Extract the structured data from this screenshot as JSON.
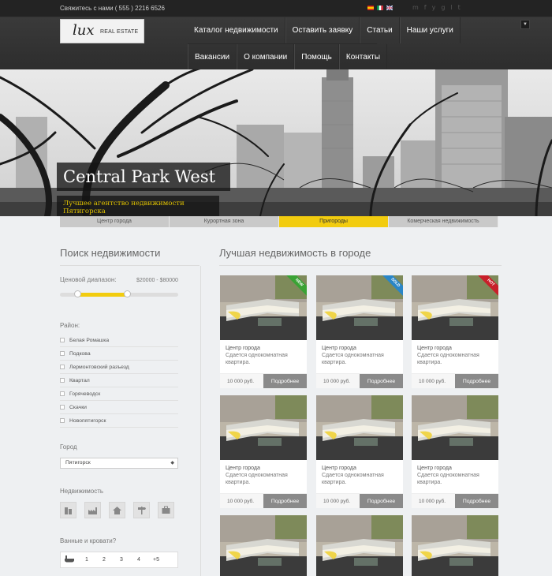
{
  "topbar": {
    "contact": "Свяжитесь с нами ( 555 ) 2216 6526",
    "social": [
      "m",
      "f",
      "y",
      "g",
      "l",
      "t"
    ]
  },
  "logo": {
    "mark": "lux",
    "text": "REAL ESTATE"
  },
  "nav": {
    "row1": [
      "Каталог недвижимости",
      "Оставить заявку",
      "Статьи",
      "Наши услуги"
    ],
    "row2": [
      "Вакансии",
      "О компании",
      "Помощь",
      "Контакты"
    ]
  },
  "hero": {
    "title": "Central Park West",
    "subtitle": "Лучшее агентство недвижимости Пятигорска"
  },
  "tabs": [
    "Центр города",
    "Курортная зона",
    "Пригороды",
    "Комерческая недвижимость"
  ],
  "active_tab": 2,
  "sidebar": {
    "title": "Поиск недвижимости",
    "price_label": "Ценовой диапазон:",
    "price_range": "$20000 - $80000",
    "district_label": "Район:",
    "districts": [
      "Белая Ромашка",
      "Подкова",
      "Лермонтовский разъезд",
      "Квартал",
      "Горячеводск",
      "Скачки",
      "Новопятигорск"
    ],
    "city_label": "Город",
    "city_value": "Пятигорск",
    "property_label": "Недвижимость",
    "property_icons": [
      "building-icon",
      "factory-icon",
      "house-icon",
      "signpost-icon",
      "briefcase-icon"
    ],
    "beds_label": "Ванные и кровати?",
    "beds_options": [
      "1",
      "2",
      "3",
      "4",
      "+5"
    ]
  },
  "main": {
    "title": "Лучшая недвижимость в городе"
  },
  "listings": [
    {
      "category": "Центр города",
      "description": "Сдается однокомнатная квартира.",
      "price": "10 000 руб.",
      "button": "Подробнее",
      "badge": "NEW",
      "badge_color": "#3aa335"
    },
    {
      "category": "Центр города",
      "description": "Сдается однокомнатная квартира.",
      "price": "10 000 руб.",
      "button": "Подробнее",
      "badge": "SOLD",
      "badge_color": "#2a86c7"
    },
    {
      "category": "Центр города",
      "description": "Сдается однокомнатная квартира.",
      "price": "10 000 руб.",
      "button": "Подробнее",
      "badge": "HOT",
      "badge_color": "#c8202a"
    },
    {
      "category": "Центр города",
      "description": "Сдается однокомнатная квартира.",
      "price": "10 000 руб.",
      "button": "Подробнее",
      "badge": "",
      "badge_color": ""
    },
    {
      "category": "Центр города",
      "description": "Сдается однокомнатная квартира.",
      "price": "10 000 руб.",
      "button": "Подробнее",
      "badge": "",
      "badge_color": ""
    },
    {
      "category": "Центр города",
      "description": "Сдается однокомнатная квартира.",
      "price": "10 000 руб.",
      "button": "Подробнее",
      "badge": "",
      "badge_color": ""
    },
    {
      "category": "",
      "description": "",
      "price": "",
      "button": "",
      "badge": "",
      "badge_color": ""
    },
    {
      "category": "",
      "description": "",
      "price": "",
      "button": "",
      "badge": "",
      "badge_color": ""
    },
    {
      "category": "",
      "description": "",
      "price": "",
      "button": "",
      "badge": "",
      "badge_color": ""
    }
  ],
  "colors": {
    "accent": "#f2cc0f",
    "dark": "#2d2d2d",
    "button": "#8a8a8a"
  }
}
